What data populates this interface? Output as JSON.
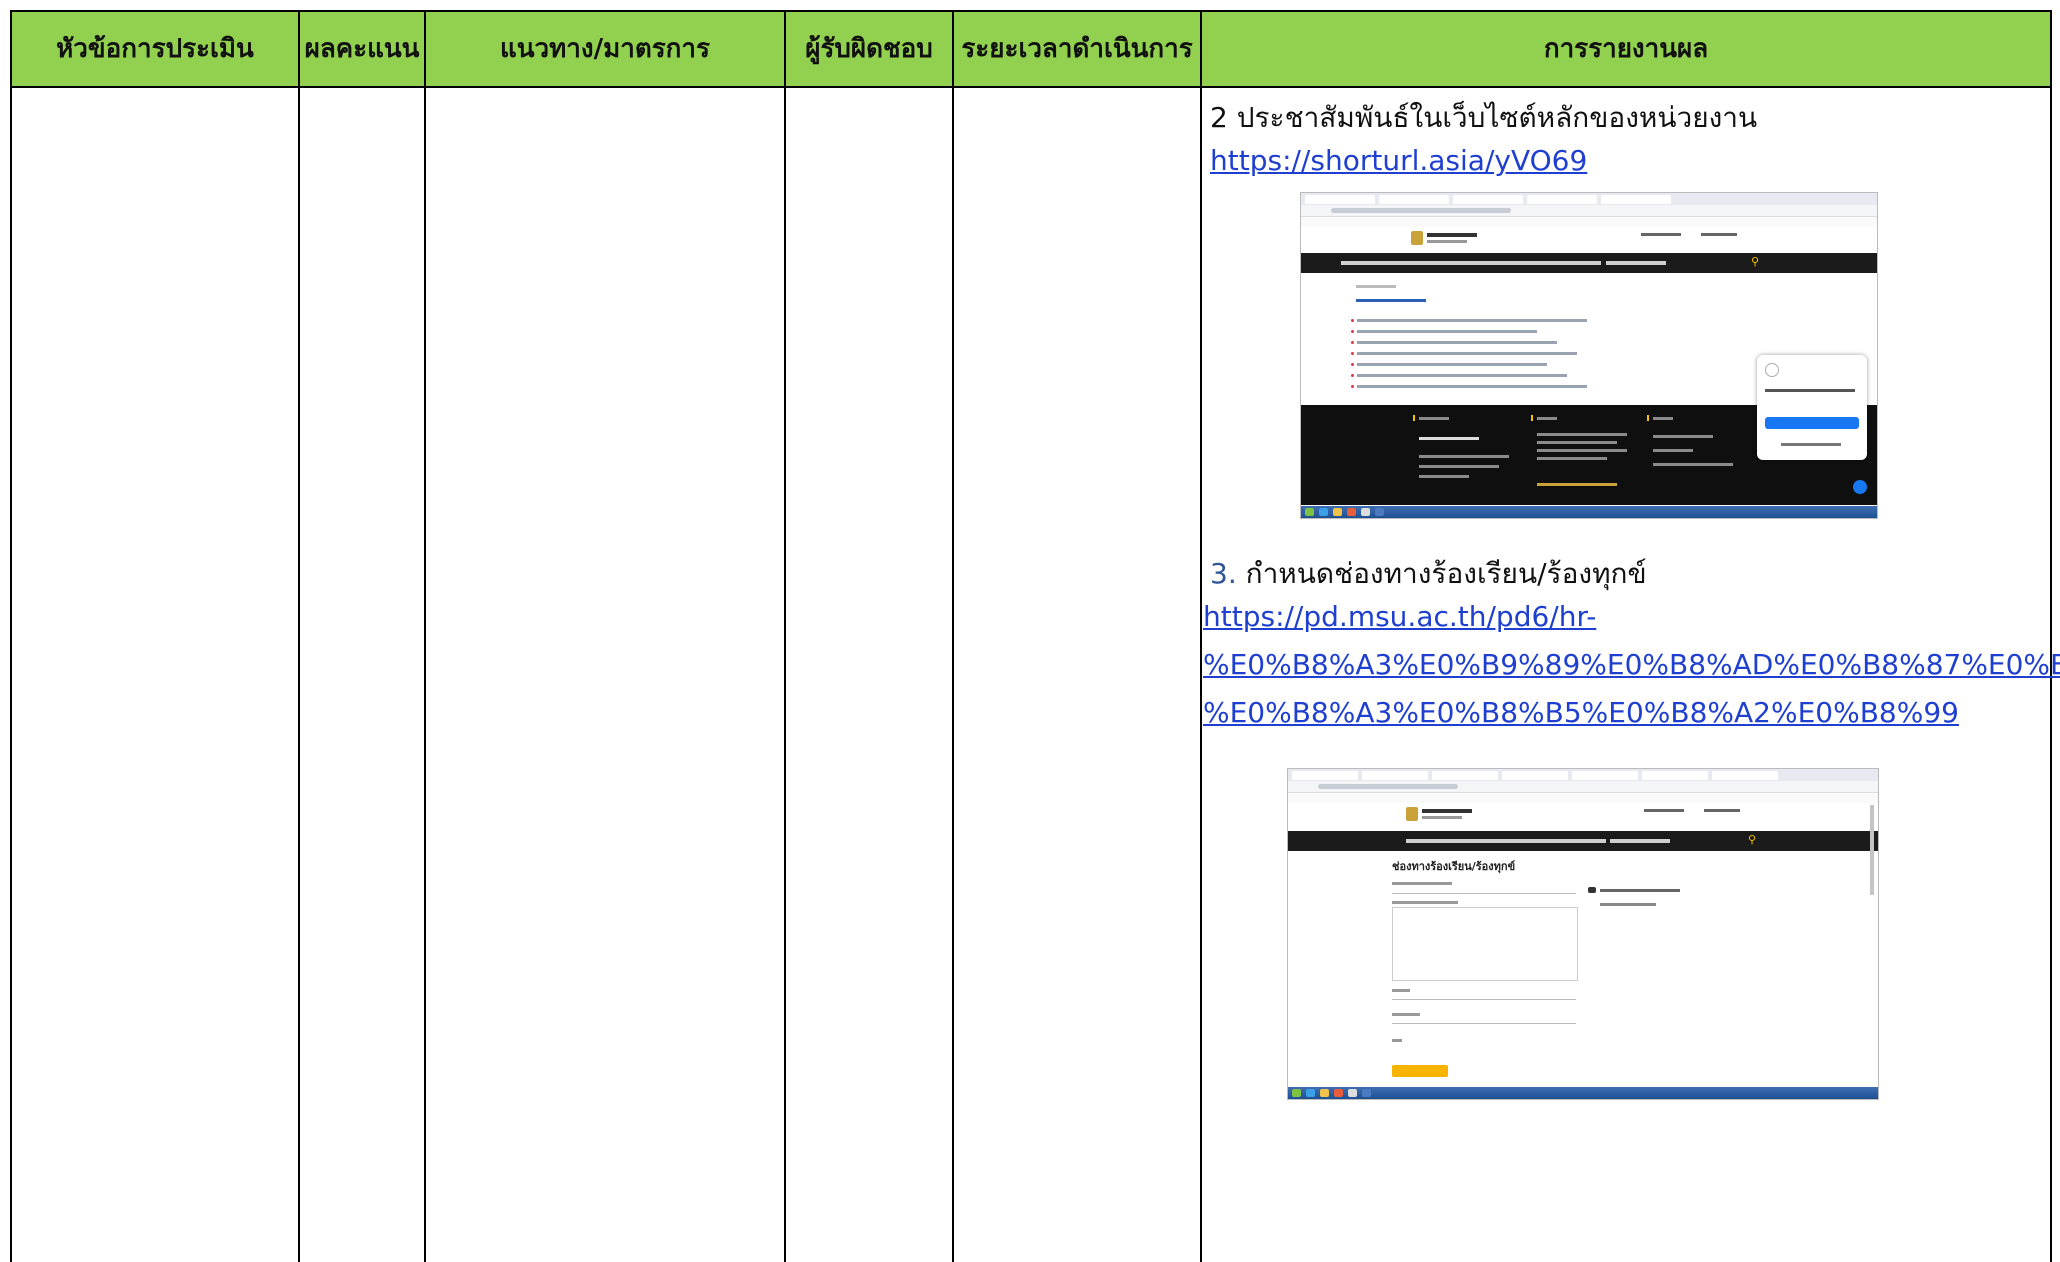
{
  "table": {
    "headers": [
      "หัวข้อการประเมิน",
      "ผลคะแนน",
      "แนวทาง/มาตรการ",
      "ผู้รับผิดชอบ",
      "ระยะเวลาดำเนินการ",
      "การรายงานผล"
    ],
    "header_color": "#92d050"
  },
  "report": {
    "item2_text": "2 ประชาสัมพันธ์ในเว็บไซต์หลักของหน่วยงาน",
    "item2_link": "https://shorturl.asia/yVO69",
    "item3_number": "3.",
    "item3_text": " กำหนดช่องทางร้องเรียน/ร้องทุกข์",
    "item3_link_line1": "https://pd.msu.ac.th/pd6/hr-",
    "item3_link_line2": "%E0%B8%A3%E0%B9%89%E0%B8%AD%E0%B8%87%E0%B9%80",
    "item3_link_line3": "%E0%B8%A3%E0%B8%B5%E0%B8%A2%E0%B8%99",
    "link_color": "#1f3fd0"
  },
  "screenshot2": {
    "form_title": "ช่องทางร้องเรียน/ร้องทุกข์"
  }
}
